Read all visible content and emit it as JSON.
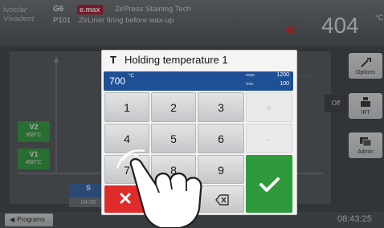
{
  "header": {
    "logo_line1": "Ivoclar",
    "logo_line2": "Vivadent",
    "program_code": "G6",
    "program_number": "P101",
    "brand": "e.max",
    "program_name_line1": "ZirPress Staining Tech.",
    "program_name_line2": "ZirLiner firing before wax-up",
    "temperature": "404",
    "temperature_unit": "°C"
  },
  "graph": {
    "v2": {
      "name": "V2",
      "value": "959°C"
    },
    "v1": {
      "name": "V1",
      "value": "450°C"
    },
    "s": {
      "name": "S",
      "value": ""
    },
    "time": "04:00"
  },
  "sidebar": {
    "options_label": "Options",
    "ir_label": "IRT",
    "admin_label": "Admin",
    "off_label": "Off"
  },
  "footer": {
    "programs_label": "Programs",
    "clock": "08:43:25"
  },
  "dialog": {
    "letter": "T",
    "title": "Holding temperature 1",
    "value": "700",
    "unit": "°C",
    "max_label": "max.",
    "max_value": "1200",
    "min_label": "min.",
    "min_value": "100",
    "keys": {
      "k1": "1",
      "k2": "2",
      "k3": "3",
      "plus": "+",
      "k4": "4",
      "k5": "5",
      "k6": "6",
      "minus": "-",
      "k7": "7",
      "k8": "8",
      "k9": "9",
      "k0": "0"
    }
  },
  "colors": {
    "value_bar": "#1f4f95",
    "confirm": "#2e9a3c",
    "cancel": "#e02b2b",
    "brand_badge": "#b3142b",
    "vacuum_flame": "#d2281e"
  }
}
